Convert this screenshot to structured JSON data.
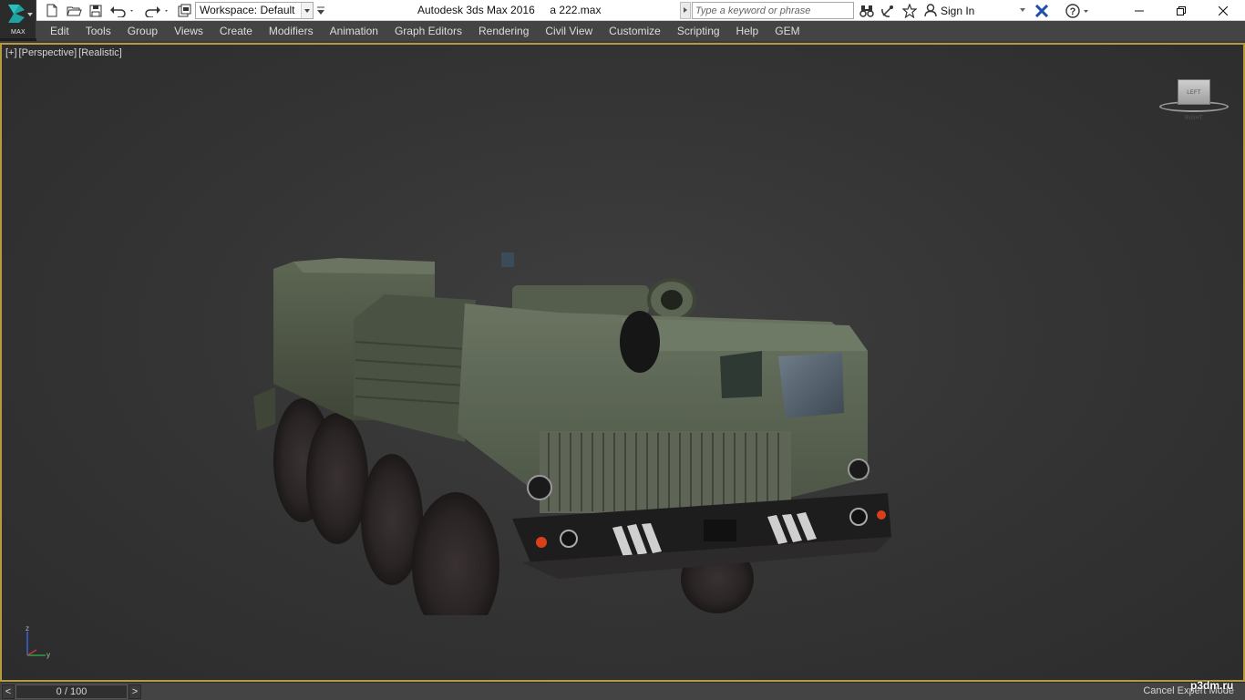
{
  "titlebar": {
    "app_logo_text": "MAX",
    "workspace_label": "Workspace: Default",
    "app_title": "Autodesk 3ds Max 2016",
    "file_name": "a 222.max",
    "search_placeholder": "Type a keyword or phrase",
    "sign_in_label": "Sign In"
  },
  "menu": {
    "items": [
      "Edit",
      "Tools",
      "Group",
      "Views",
      "Create",
      "Modifiers",
      "Animation",
      "Graph Editors",
      "Rendering",
      "Civil View",
      "Customize",
      "Scripting",
      "Help",
      "GEM"
    ]
  },
  "viewport": {
    "label_plus": "[+]",
    "label_view": "[Perspective]",
    "label_shading": "[Realistic]",
    "viewcube_face": "LEFT RIGHT",
    "axis_z": "z",
    "axis_y": "y",
    "border_color": "#b59a3e"
  },
  "statusbar": {
    "time_prev": "<",
    "time_slider": "0 / 100",
    "time_next": ">",
    "cancel_expert_mode": "Cancel Expert Mode"
  },
  "watermark": "p3dm.ru",
  "icons": [
    "new-file-icon",
    "open-file-icon",
    "save-icon",
    "undo-icon",
    "redo-icon",
    "project-folder-icon",
    "binoculars-icon",
    "satellite-icon",
    "star-icon",
    "user-icon",
    "exchange-icon",
    "help-icon",
    "minimize-icon",
    "restore-icon",
    "close-icon"
  ]
}
